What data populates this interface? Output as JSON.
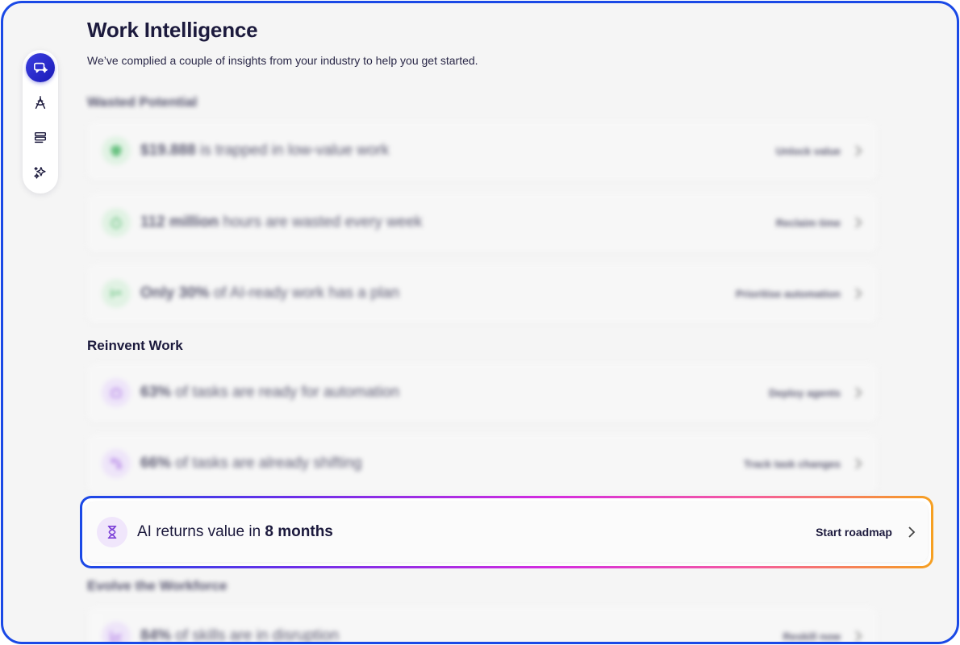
{
  "header": {
    "title": "Work Intelligence",
    "subtitle": "We’ve complied a couple of insights from your industry to help you get started."
  },
  "rail": {
    "items": [
      {
        "icon": "chat-sparkle-icon",
        "active": true
      },
      {
        "icon": "compass-pen-icon",
        "active": false
      },
      {
        "icon": "stack-icon",
        "active": false
      },
      {
        "icon": "sparkles-icon",
        "active": false
      }
    ]
  },
  "sections": {
    "wasted": {
      "title": "Wasted Potential",
      "cards": [
        {
          "bold": "$19.888",
          "rest": " is trapped in low-value work",
          "action": "Unlock value",
          "icon": "shield-icon",
          "color": "green"
        },
        {
          "bold": "112 million",
          "rest": " hours are wasted every week",
          "action": "Reclaim time",
          "icon": "timer-icon",
          "color": "green"
        },
        {
          "bold": "Only 30%",
          "rest": " of AI-ready work has a plan",
          "action": "Prioritise automation",
          "icon": "arrow-icon",
          "color": "green"
        }
      ]
    },
    "reinvent": {
      "title": "Reinvent Work",
      "cards": [
        {
          "bold": "63%",
          "rest": " of tasks are ready for automation",
          "action": "Deploy agents",
          "icon": "robot-icon",
          "color": "purple"
        },
        {
          "bold": "66%",
          "rest": " of tasks are already shifting",
          "action": "Track task changes",
          "icon": "shift-icon",
          "color": "purple"
        }
      ],
      "highlight": {
        "prefix": "AI returns value in ",
        "bold": "8 months",
        "action": "Start roadmap",
        "icon": "hourglass-icon"
      }
    },
    "evolve": {
      "title": "Evolve the Workforce",
      "cards": [
        {
          "bold": "84%",
          "rest": " of skills are in disruption",
          "action": "Reskill now",
          "icon": "chart-icon",
          "color": "purple"
        }
      ]
    }
  },
  "colors": {
    "frame": "#1a49e6",
    "title": "#1c1a3d",
    "gradient": [
      "#1a49e6",
      "#6b2ee8",
      "#d42be0",
      "#f55aa0",
      "#f6a020"
    ]
  }
}
